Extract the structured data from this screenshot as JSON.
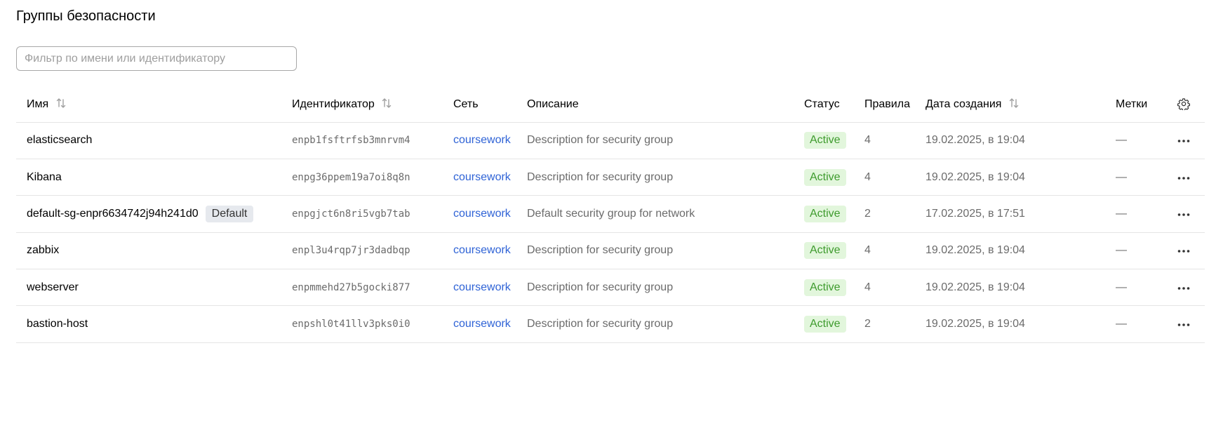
{
  "page": {
    "title": "Группы безопасности"
  },
  "filter": {
    "placeholder": "Фильтр по имени или идентификатору",
    "value": ""
  },
  "columns": {
    "name": "Имя",
    "id": "Идентификатор",
    "network": "Сеть",
    "description": "Описание",
    "status": "Статус",
    "rules": "Правила",
    "created": "Дата создания",
    "labels": "Метки"
  },
  "rows": [
    {
      "name": "elasticsearch",
      "badge": "",
      "id": "enpb1fsftrfsb3mnrvm4",
      "network": "coursework",
      "description": "Description for security group",
      "status": "Active",
      "rules": "4",
      "created": "19.02.2025, в 19:04",
      "labels": "—"
    },
    {
      "name": "Kibana",
      "badge": "",
      "id": "enpg36ppem19a7oi8q8n",
      "network": "coursework",
      "description": "Description for security group",
      "status": "Active",
      "rules": "4",
      "created": "19.02.2025, в 19:04",
      "labels": "—"
    },
    {
      "name": "default-sg-enpr6634742j94h241d0",
      "badge": "Default",
      "id": "enpgjct6n8ri5vgb7tab",
      "network": "coursework",
      "description": "Default security group for network",
      "status": "Active",
      "rules": "2",
      "created": "17.02.2025, в 17:51",
      "labels": "—"
    },
    {
      "name": "zabbix",
      "badge": "",
      "id": "enpl3u4rqp7jr3dadbqp",
      "network": "coursework",
      "description": "Description for security group",
      "status": "Active",
      "rules": "4",
      "created": "19.02.2025, в 19:04",
      "labels": "—"
    },
    {
      "name": "webserver",
      "badge": "",
      "id": "enpmmehd27b5gocki877",
      "network": "coursework",
      "description": "Description for security group",
      "status": "Active",
      "rules": "4",
      "created": "19.02.2025, в 19:04",
      "labels": "—"
    },
    {
      "name": "bastion-host",
      "badge": "",
      "id": "enpshl0t41llv3pks0i0",
      "network": "coursework",
      "description": "Description for security group",
      "status": "Active",
      "rules": "2",
      "created": "19.02.2025, в 19:04",
      "labels": "—"
    }
  ],
  "icons": {
    "sort": "sort-icon",
    "settings": "gear-icon",
    "row_actions": "more-horizontal-icon"
  },
  "colors": {
    "link": "#2f63d6",
    "status_active_bg": "#e2f6dc",
    "status_active_text": "#3e9b2d",
    "badge_default_bg": "#e6e9ee"
  }
}
